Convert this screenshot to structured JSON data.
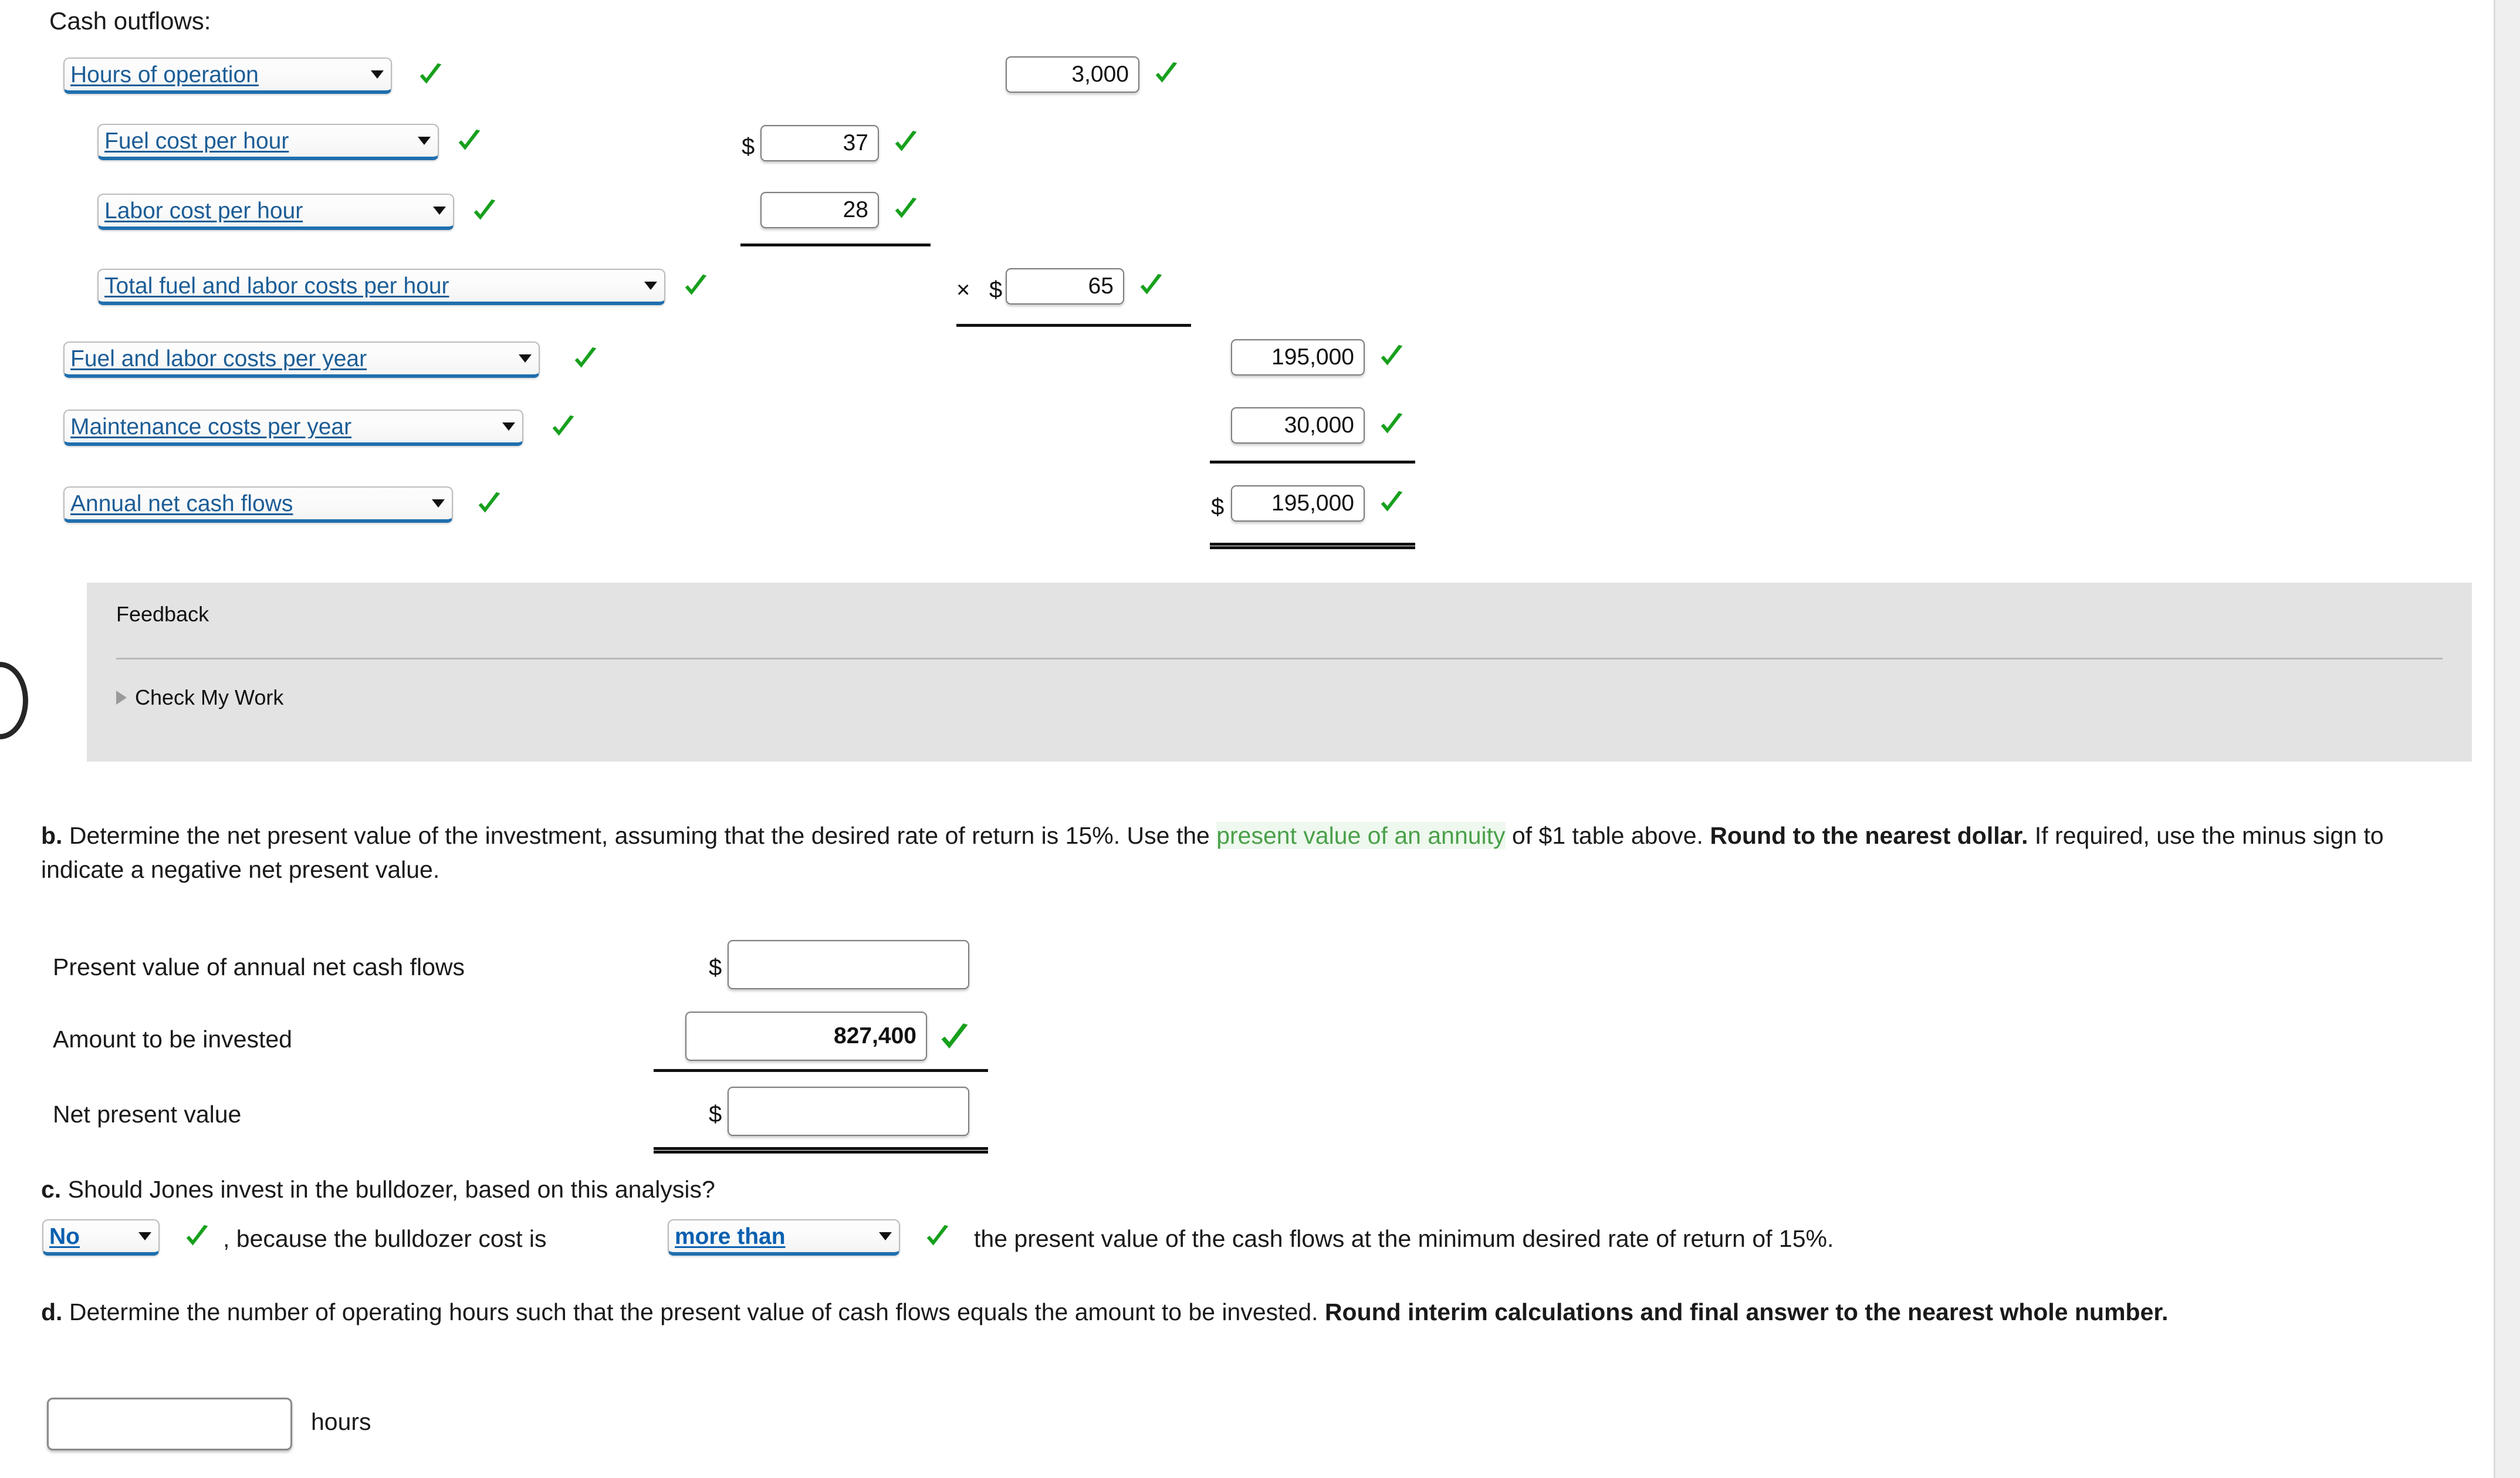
{
  "section": {
    "heading": "Cash outflows:"
  },
  "schedule": {
    "rows": [
      {
        "id": "hours-of-operation",
        "dropdown": "Hours of operation",
        "dropdown_checked": true,
        "value": "3,000",
        "value_checked": true,
        "currency": "",
        "operator": ""
      },
      {
        "id": "fuel-cost-per-hour",
        "dropdown": "Fuel cost per hour",
        "dropdown_checked": true,
        "value": "37",
        "value_checked": true,
        "currency": "$",
        "operator": ""
      },
      {
        "id": "labor-cost-per-hour",
        "dropdown": "Labor cost per hour",
        "dropdown_checked": true,
        "value": "28",
        "value_checked": true,
        "currency": "",
        "operator": ""
      },
      {
        "id": "total-fuel-and-labor-costs-per-hour",
        "dropdown": "Total fuel and labor costs per hour",
        "dropdown_checked": true,
        "value": "65",
        "value_checked": true,
        "currency": "$",
        "operator": "×"
      },
      {
        "id": "fuel-and-labor-costs-per-year",
        "dropdown": "Fuel and labor costs per year",
        "dropdown_checked": true,
        "value": "195,000",
        "value_checked": true,
        "currency": "",
        "operator": ""
      },
      {
        "id": "maintenance-costs-per-year",
        "dropdown": "Maintenance costs per year",
        "dropdown_checked": true,
        "value": "30,000",
        "value_checked": true,
        "currency": "",
        "operator": ""
      },
      {
        "id": "annual-net-cash-flows",
        "dropdown": "Annual net cash flows",
        "dropdown_checked": true,
        "value": "195,000",
        "value_checked": true,
        "currency": "$",
        "operator": ""
      }
    ]
  },
  "feedback": {
    "title": "Feedback",
    "check_my_work": "Check My Work"
  },
  "part_b": {
    "marker": "b.",
    "text_1": " Determine the net present value of the investment, assuming that the desired rate of return is 15%. Use the ",
    "link": "present value of an annuity",
    "text_2": " of $1 table above. ",
    "bold_1": "Round to the nearest dollar.",
    "text_3": " If required, use the minus sign to indicate a negative net present value.",
    "rows": [
      {
        "label": "Present value of annual net cash flows",
        "currency": "$",
        "value": "",
        "checked": false,
        "bold": false
      },
      {
        "label": "Amount to be invested",
        "currency": "",
        "value": "827,400",
        "checked": true,
        "bold": true
      },
      {
        "label": "Net present value",
        "currency": "$",
        "value": "",
        "checked": false,
        "bold": false
      }
    ]
  },
  "part_c": {
    "marker": "c.",
    "question": " Should Jones invest in the bulldozer, based on this analysis?",
    "answer_dropdown": "No",
    "answer_checked": true,
    "middle_text": ", because the bulldozer cost is",
    "comparison_dropdown": "more than",
    "comparison_checked": true,
    "tail_text": "the present value of the cash flows at the minimum desired rate of return of 15%."
  },
  "part_d": {
    "marker": "d.",
    "text_1": " Determine the number of operating hours such that the present value of cash flows equals the amount to be invested. ",
    "bold_1": "Round interim calculations and final answer to the nearest whole number.",
    "input_value": "",
    "unit_label": "hours"
  },
  "colors": {
    "check_green": "#17a01d",
    "dropdown_blue": "#1c5d96",
    "link_green": "#4aa04a",
    "feedback_bg": "#e3e3e3"
  },
  "icons": {
    "check": "check-icon",
    "caret": "chevron-down-icon",
    "disclosure": "disclosure-triangle-icon"
  }
}
